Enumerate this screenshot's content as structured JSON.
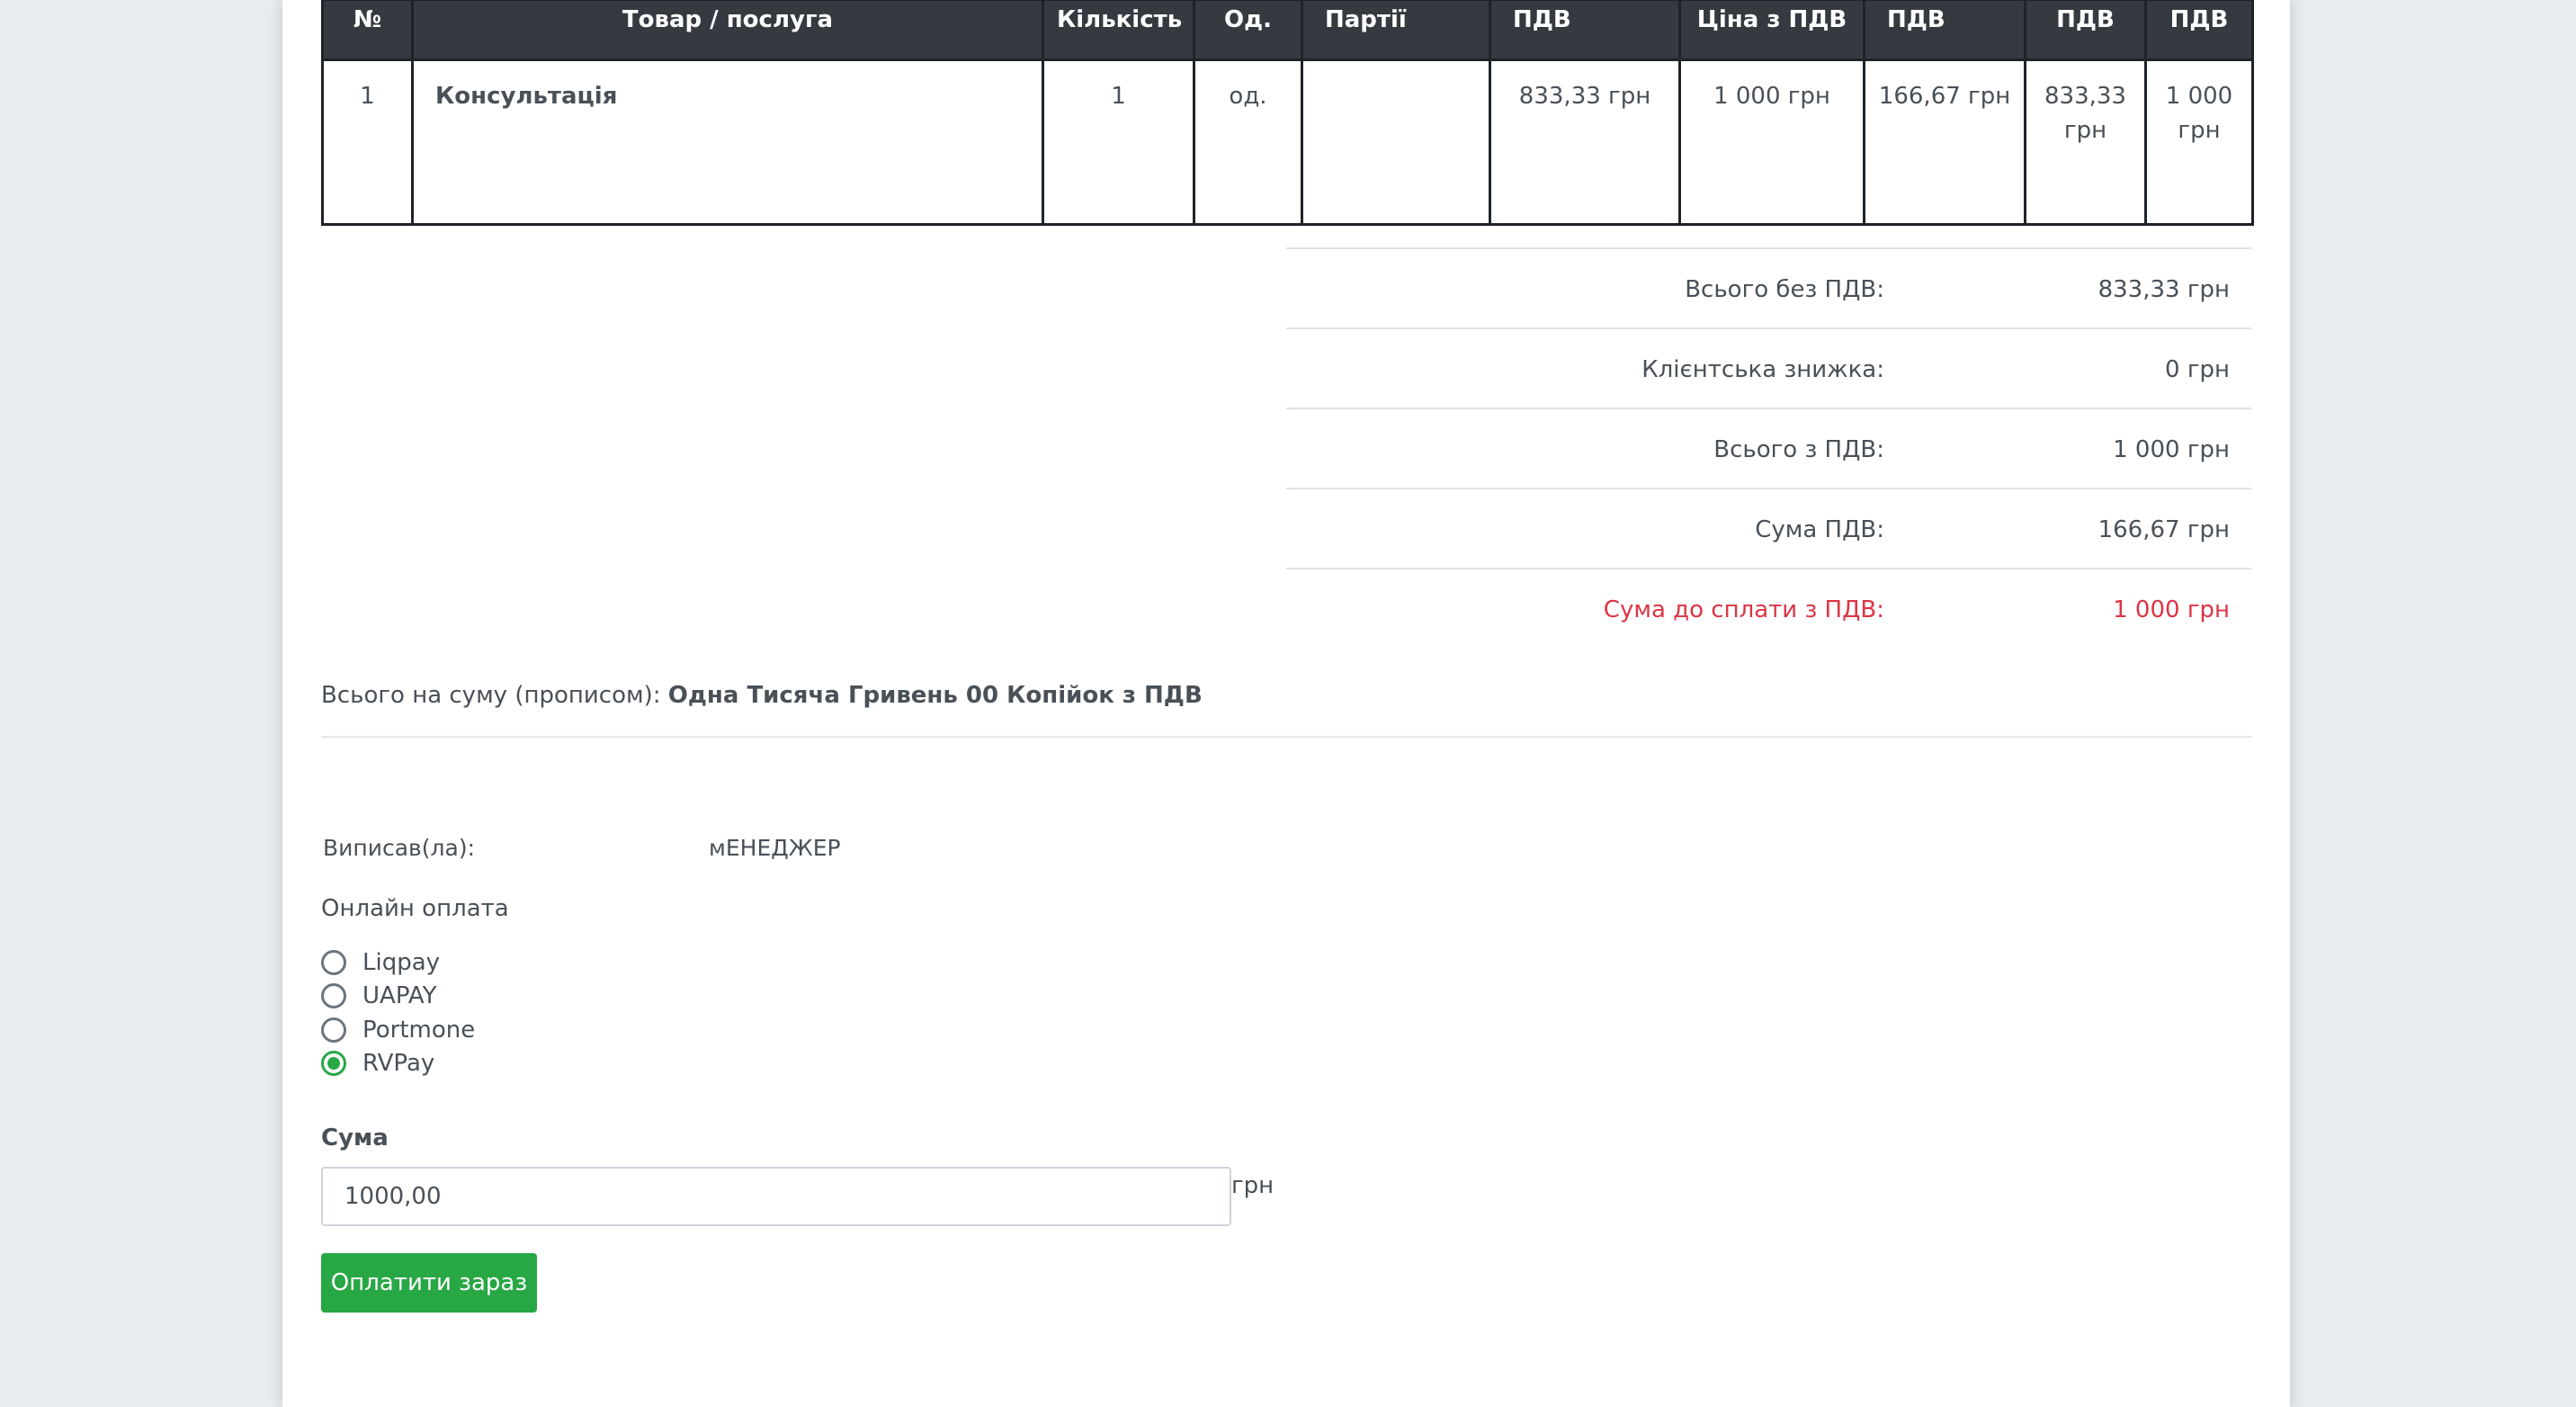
{
  "table": {
    "headers": [
      "№",
      "Товар / послуга",
      "Кількість",
      "Од.",
      "Партії",
      "ПДВ",
      "Ціна з ПДВ",
      "ПДВ",
      "ПДВ",
      "ПДВ"
    ],
    "rows": [
      [
        "1",
        "Консультація",
        "1",
        "од.",
        "",
        "833,33 грн",
        "1 000 грн",
        "166,67 грн",
        "833,33 грн",
        "1 000 грн"
      ]
    ]
  },
  "totals": [
    {
      "label": "Всього без ПДВ:",
      "value": "833,33 грн"
    },
    {
      "label": "Клієнтська знижка:",
      "value": "0 грн"
    },
    {
      "label": "Всього з ПДВ:",
      "value": "1 000 грн"
    },
    {
      "label": "Сума ПДВ:",
      "value": "166,67 грн"
    },
    {
      "label": "Сума до сплати з ПДВ:",
      "value": "1 000 грн",
      "highlight": true
    }
  ],
  "amount_in_words": {
    "label": "Всього на суму (прописом):",
    "value": "Одна Тисяча Гривень 00 Копійок з ПДВ"
  },
  "issued_by": {
    "label": "Виписав(ла):",
    "value": "мЕНЕДЖЕР"
  },
  "online_payment": {
    "title": "Онлайн оплата",
    "options": [
      {
        "label": "Liqpay",
        "selected": false
      },
      {
        "label": "UAPAY",
        "selected": false
      },
      {
        "label": "Portmone",
        "selected": false
      },
      {
        "label": "RVPay",
        "selected": true
      }
    ],
    "sum_label": "Сума",
    "sum_value": "1000,00",
    "currency": "грн",
    "pay_button": "Оплатити зараз"
  },
  "colors": {
    "header_bg": "#343a40",
    "accent_green": "#28a745",
    "highlight_red": "#dc3545"
  }
}
